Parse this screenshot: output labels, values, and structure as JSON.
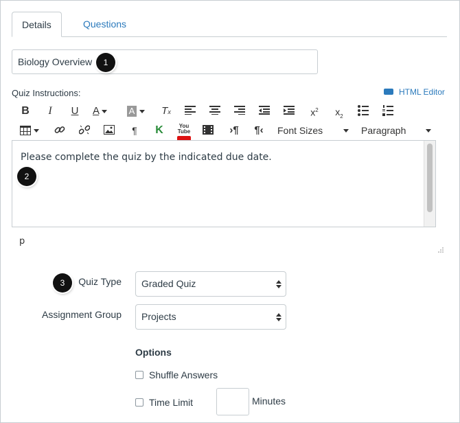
{
  "tabs": [
    {
      "label": "Details"
    },
    {
      "label": "Questions"
    }
  ],
  "title_field": {
    "value": "Biology Overview"
  },
  "badges": [
    "1",
    "2",
    "3"
  ],
  "instructions": {
    "label": "Quiz Instructions:",
    "html_editor_link": "HTML Editor",
    "toolbar": {
      "font_sizes_label": "Font Sizes",
      "paragraph_label": "Paragraph",
      "youtube_label": "You Tube"
    },
    "content": "Please complete the quiz by the indicated due date.",
    "path": "p"
  },
  "quiz_type": {
    "label": "Quiz Type",
    "value": "Graded Quiz"
  },
  "assignment_group": {
    "label": "Assignment Group",
    "value": "Projects"
  },
  "options": {
    "heading": "Options",
    "shuffle_answers": {
      "label": "Shuffle Answers",
      "checked": false
    },
    "time_limit": {
      "label": "Time Limit",
      "checked": false,
      "unit": "Minutes"
    }
  },
  "colors": {
    "link": "#2b7abc",
    "text": "#2d3b45",
    "border": "#c7cdd1"
  }
}
